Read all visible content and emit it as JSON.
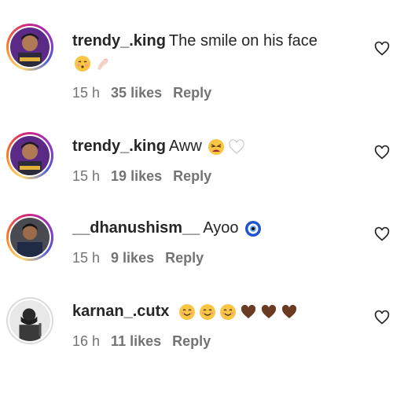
{
  "comments": [
    {
      "username": "trendy_.king",
      "text": "The smile on his face",
      "emojis": [
        "kissing-face-emoji",
        "pinched-fingers-emoji"
      ],
      "time": "15 h",
      "likes": "35 likes",
      "reply": "Reply",
      "avatar": "profile-photo-trendy-king"
    },
    {
      "username": "trendy_.king",
      "text": "Aww",
      "emojis": [
        "tired-face-emoji",
        "white-heart-emoji"
      ],
      "time": "15 h",
      "likes": "19 likes",
      "reply": "Reply",
      "avatar": "profile-photo-trendy-king"
    },
    {
      "username": "__dhanushism__",
      "text": "Ayoo",
      "emojis": [
        "nazar-amulet-emoji"
      ],
      "time": "15 h",
      "likes": "9 likes",
      "reply": "Reply",
      "avatar": "profile-photo-dhanushism"
    },
    {
      "username": "karnan_.cutx",
      "text": "",
      "emojis": [
        "smiling-face-emoji",
        "smiling-face-emoji",
        "smiling-face-emoji",
        "brown-heart-emoji",
        "brown-heart-emoji",
        "brown-heart-emoji"
      ],
      "time": "16 h",
      "likes": "11 likes",
      "reply": "Reply",
      "avatar": "profile-photo-karnan-cutx"
    }
  ],
  "like_icon": "heart-outline-icon"
}
